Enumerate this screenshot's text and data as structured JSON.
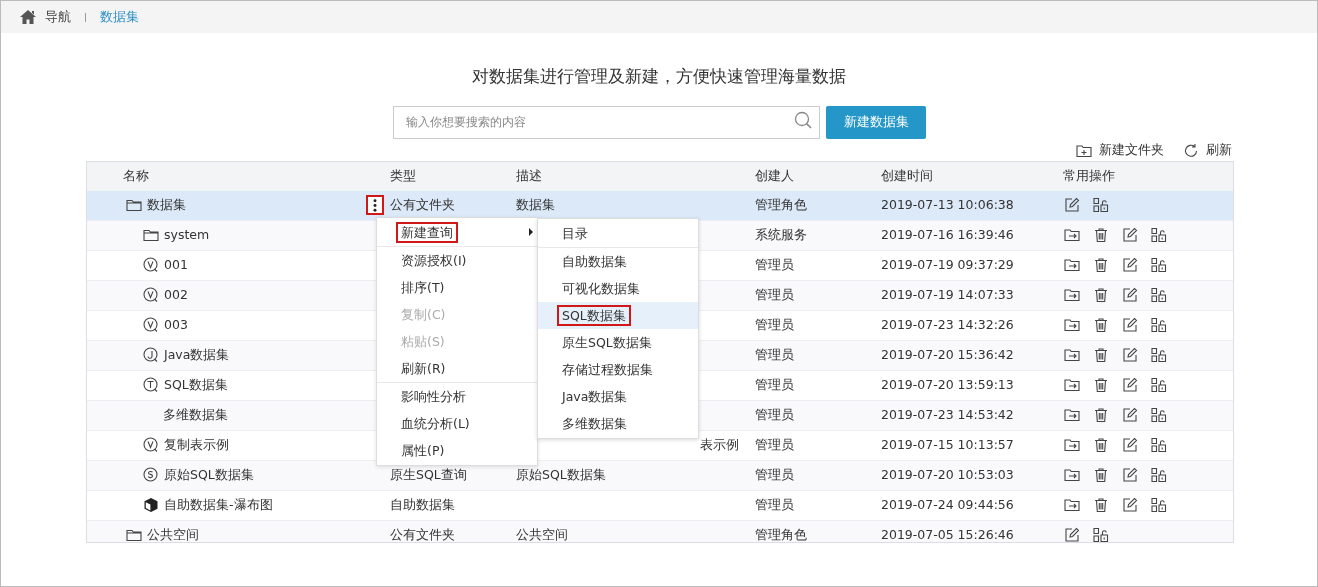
{
  "breadcrumb": {
    "home": "导航",
    "current": "数据集"
  },
  "headline": "对数据集进行管理及新建，方便快速管理海量数据",
  "search": {
    "placeholder": "输入你想要搜索的内容"
  },
  "create_button": "新建数据集",
  "toolbar": [
    "新建文件夹",
    "刷新"
  ],
  "table": {
    "columns": [
      "名称",
      "类型",
      "描述",
      "创建人",
      "创建时间",
      "常用操作"
    ],
    "rows": [
      {
        "kind": "folder",
        "name": "数据集",
        "type": "公有文件夹",
        "description": "数据集",
        "creator": "管理角色",
        "created": "2019-07-13 10:06:38",
        "selected": true,
        "more_button": {
          "annotated": true
        },
        "children": [
          {
            "kind": "folder",
            "name": "system",
            "creator": "系统服务",
            "created": "2019-07-16 16:39:46",
            "selected": false
          },
          {
            "kind": "view",
            "name": "001",
            "creator": "管理员",
            "created": "2019-07-19 09:37:29",
            "selected": false
          },
          {
            "kind": "view",
            "name": "002",
            "creator": "管理员",
            "created": "2019-07-19 14:07:33",
            "selected": false
          },
          {
            "kind": "view",
            "name": "003",
            "creator": "管理员",
            "created": "2019-07-23 14:32:26",
            "selected": false
          },
          {
            "kind": "java",
            "name": "Java数据集",
            "creator": "管理员",
            "created": "2019-07-20 15:36:42",
            "selected": false
          },
          {
            "kind": "table",
            "name": "SQL数据集",
            "creator": "管理员",
            "created": "2019-07-20 13:59:13",
            "selected": false
          },
          {
            "kind": "plain",
            "name": "多维数据集",
            "creator": "管理员",
            "created": "2019-07-23 14:53:42",
            "selected": false
          },
          {
            "kind": "view",
            "name": "复制表示例",
            "description": "表示例",
            "description_partial": true,
            "creator": "管理员",
            "created": "2019-07-15 10:13:57",
            "selected": false
          },
          {
            "kind": "sql",
            "name": "原始SQL数据集",
            "type": "原生SQL查询",
            "description": "原始SQL数据集",
            "creator": "管理员",
            "created": "2019-07-20 10:53:03",
            "selected": false
          },
          {
            "kind": "cube",
            "name": "自助数据集-瀑布图",
            "type": "自助数据集",
            "creator": "管理员",
            "created": "2019-07-24 09:44:56",
            "selected": false
          }
        ]
      },
      {
        "kind": "folder",
        "name": "公共空间",
        "type": "公有文件夹",
        "description": "公共空间",
        "creator": "管理角色",
        "created": "2019-07-05 15:26:46",
        "selected": false
      }
    ]
  },
  "context_menu": {
    "groups": [
      [
        {
          "label": "新建查询",
          "annotated": true,
          "disabled": false,
          "submenu": {
            "groups": [
              [
                {
                  "label": "目录",
                  "selected": false,
                  "annotated": false
                }
              ],
              [
                {
                  "label": "自助数据集",
                  "selected": false,
                  "annotated": false
                },
                {
                  "label": "可视化数据集",
                  "selected": false,
                  "annotated": false
                },
                {
                  "label": "SQL数据集",
                  "selected": true,
                  "annotated": true
                },
                {
                  "label": "原生SQL数据集",
                  "selected": false,
                  "annotated": false
                },
                {
                  "label": "存储过程数据集",
                  "selected": false,
                  "annotated": false
                },
                {
                  "label": "Java数据集",
                  "selected": false,
                  "annotated": false
                },
                {
                  "label": "多维数据集",
                  "selected": false,
                  "annotated": false
                }
              ]
            ]
          }
        }
      ],
      [
        {
          "label": "资源授权(I)",
          "annotated": false,
          "disabled": false
        },
        {
          "label": "排序(T)",
          "annotated": false,
          "disabled": false
        },
        {
          "label": "复制(C)",
          "annotated": false,
          "disabled": true
        },
        {
          "label": "粘贴(S)",
          "annotated": false,
          "disabled": true
        },
        {
          "label": "刷新(R)",
          "annotated": false,
          "disabled": false
        }
      ],
      [
        {
          "label": "影响性分析",
          "annotated": false,
          "disabled": false
        },
        {
          "label": "血统分析(L)",
          "annotated": false,
          "disabled": false
        },
        {
          "label": "属性(P)",
          "annotated": false,
          "disabled": false
        }
      ]
    ]
  }
}
